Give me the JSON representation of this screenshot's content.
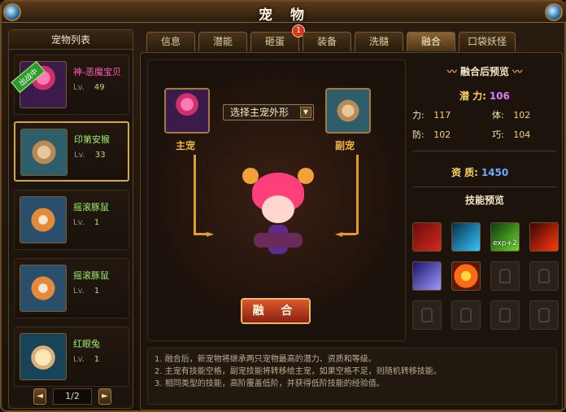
{
  "window": {
    "title": "宠 物"
  },
  "left_panel": {
    "header": "宠物列表",
    "pets": [
      {
        "name": "神-恶魔宝贝",
        "level_label": "Lv.",
        "level": "49",
        "name_color": "#ff5cba",
        "badge": "出战中"
      },
      {
        "name": "印第安猴",
        "level_label": "Lv.",
        "level": "33",
        "name_color": "#9ff06a"
      },
      {
        "name": "摇滚豚鼠",
        "level_label": "Lv.",
        "level": "1",
        "name_color": "#9ff06a"
      },
      {
        "name": "摇滚豚鼠",
        "level_label": "Lv.",
        "level": "1",
        "name_color": "#9ff06a"
      },
      {
        "name": "红眼兔",
        "level_label": "Lv.",
        "level": "1",
        "name_color": "#9ff06a"
      }
    ],
    "pager": {
      "text": "1/2",
      "prev": "◄",
      "next": "►"
    }
  },
  "tabs": [
    {
      "label": "信息"
    },
    {
      "label": "潜能"
    },
    {
      "label": "砸蛋",
      "badge": "1"
    },
    {
      "label": "装备"
    },
    {
      "label": "洗髓"
    },
    {
      "label": "融合",
      "active": true
    },
    {
      "label": "口袋妖怪"
    }
  ],
  "fusion": {
    "main_label": "主宠",
    "sub_label": "副宠",
    "select_label": "选择主宠外形",
    "fuse_button": "融 合"
  },
  "preview": {
    "title": "融合后预览",
    "potential_label": "潜 力:",
    "potential": "106",
    "stats": [
      {
        "label": "力:",
        "value": "117"
      },
      {
        "label": "体:",
        "value": "102"
      },
      {
        "label": "防:",
        "value": "102"
      },
      {
        "label": "巧:",
        "value": "104"
      }
    ],
    "aptitude_label": "资 质:",
    "aptitude": "1450",
    "skills_title": "技能预览",
    "skill_badge": "exp+2"
  },
  "tips": [
    "1. 融合后，新宠物将继承两只宠物最高的潜力、资质和等级。",
    "2. 主宠有技能空格，副宠技能将转移给主宠，如果空格不足，则随机转移技能。",
    "3. 相同类型的技能，高阶覆盖低阶，并获得低阶技能的经验值。"
  ]
}
